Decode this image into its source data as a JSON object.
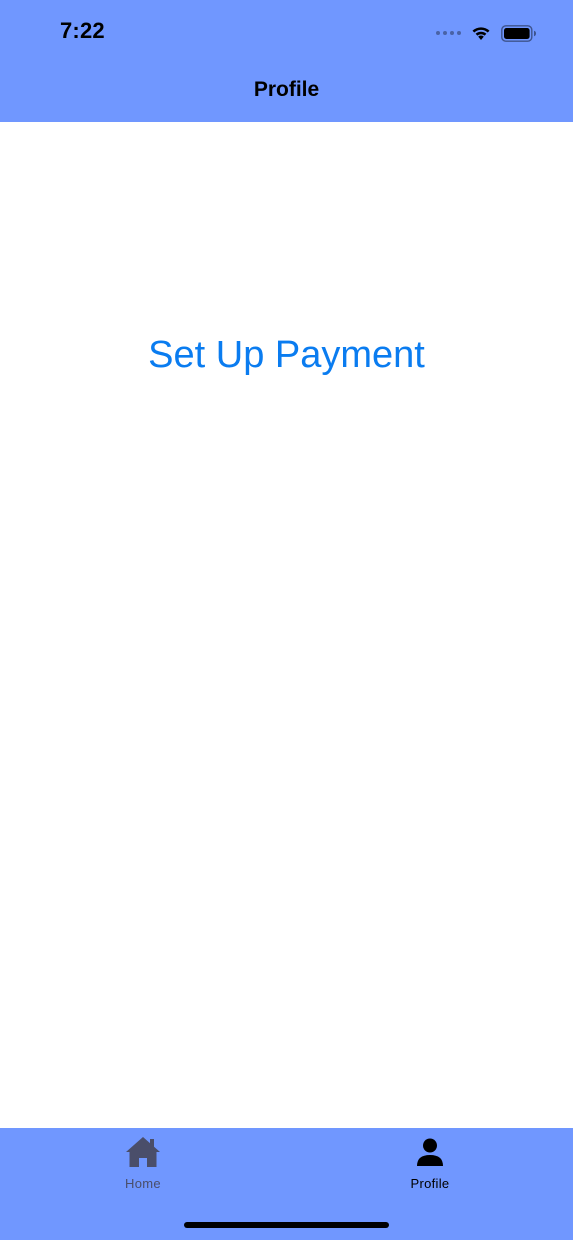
{
  "status_bar": {
    "time": "7:22",
    "icons": [
      "signal-dots-icon",
      "wifi-icon",
      "battery-icon"
    ]
  },
  "nav": {
    "title": "Profile"
  },
  "main": {
    "setup_payment_label": "Set Up Payment"
  },
  "tab_bar": {
    "items": [
      {
        "label": "Home",
        "icon": "house-icon",
        "selected": false
      },
      {
        "label": "Profile",
        "icon": "person-icon",
        "selected": true
      }
    ]
  },
  "colors": {
    "bar_background": "#7097ff",
    "link_blue": "#0a7cf0",
    "content_background": "#ffffff"
  }
}
